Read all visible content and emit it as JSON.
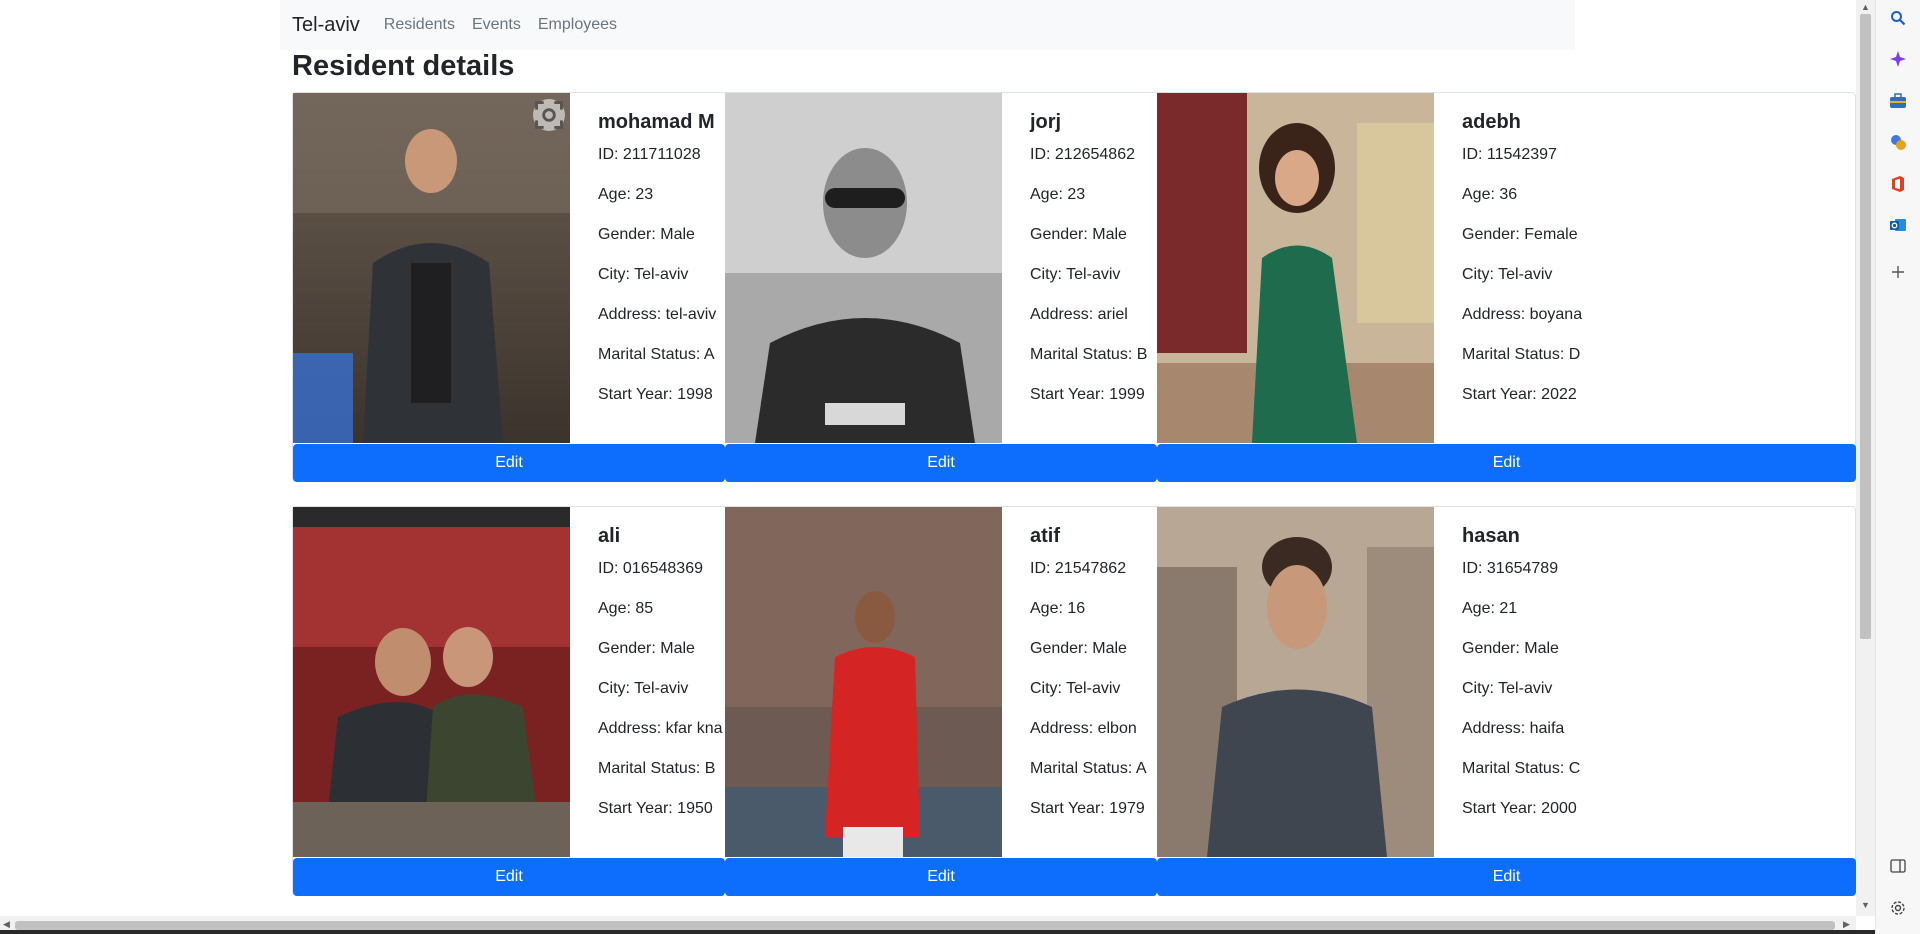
{
  "navbar": {
    "brand": "Tel-aviv",
    "links": [
      "Residents",
      "Events",
      "Employees"
    ]
  },
  "page_title": "Resident details",
  "labels": {
    "id": "ID:",
    "age": "Age:",
    "gender": "Gender:",
    "city": "City:",
    "address": "Address:",
    "marital": "Marital Status:",
    "start": "Start Year:",
    "edit": "Edit"
  },
  "residents": [
    {
      "name": "mohamad M",
      "id": "211711028",
      "age": "23",
      "gender": "Male",
      "city": "Tel-aviv",
      "address": "tel-aviv",
      "marital": "A",
      "start": "1998"
    },
    {
      "name": "jorj",
      "id": "212654862",
      "age": "23",
      "gender": "Male",
      "city": "Tel-aviv",
      "address": "ariel",
      "marital": "B",
      "start": "1999"
    },
    {
      "name": "adebh",
      "id": "11542397",
      "age": "36",
      "gender": "Female",
      "city": "Tel-aviv",
      "address": "boyana",
      "marital": "D",
      "start": "2022"
    },
    {
      "name": "ali",
      "id": "016548369",
      "age": "85",
      "gender": "Male",
      "city": "Tel-aviv",
      "address": "kfar kna",
      "marital": "B",
      "start": "1950"
    },
    {
      "name": "atif",
      "id": "21547862",
      "age": "16",
      "gender": "Male",
      "city": "Tel-aviv",
      "address": "elbon",
      "marital": "A",
      "start": "1979"
    },
    {
      "name": "hasan",
      "id": "31654789",
      "age": "21",
      "gender": "Male",
      "city": "Tel-aviv",
      "address": "haifa",
      "marital": "C",
      "start": "2000"
    }
  ],
  "sidebar_icons": [
    "search-icon",
    "copilot-icon",
    "briefcase-icon",
    "games-icon",
    "office-icon",
    "outlook-icon",
    "add-icon",
    "split-screen-icon",
    "settings-icon"
  ],
  "colors": {
    "accent": "#0d6efd",
    "navbar_bg": "#f8f9fa"
  }
}
